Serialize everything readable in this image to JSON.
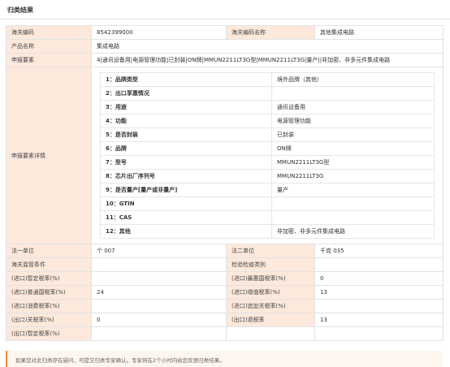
{
  "header": {
    "title": "归类结果"
  },
  "basic": {
    "hs_code_label": "海关编码",
    "hs_code": "8542399000",
    "hs_name_label": "海关编码名称",
    "hs_name": "其他集成电路",
    "product_label": "产品名称",
    "product": "集成电路",
    "elements_label": "申报要素",
    "elements": "4|通讯设备用|电源管理功能|已封装|ON牌|MMUN2211LT3G型|MMUN2211LT3G|量产||非加密、非多元件集成电路",
    "details_label": "申报要素详情"
  },
  "details": [
    {
      "key": "1：品牌类型",
      "value": "境外品牌（其他）"
    },
    {
      "key": "2：出口享惠情况",
      "value": ""
    },
    {
      "key": "3：用途",
      "value": "通讯设备用"
    },
    {
      "key": "4：功能",
      "value": "电源管理功能"
    },
    {
      "key": "5：是否封装",
      "value": "已封装"
    },
    {
      "key": "6：品牌",
      "value": "ON牌"
    },
    {
      "key": "7：型号",
      "value": "MMUN2211LT3G型"
    },
    {
      "key": "8：芯片出厂序列号",
      "value": "MMUN2211LT3G"
    },
    {
      "key": "9：是否量产[量产或非量产]",
      "value": "量产"
    },
    {
      "key": "10：GTIN",
      "value": ""
    },
    {
      "key": "11：CAS",
      "value": ""
    },
    {
      "key": "12：其他",
      "value": "非加密、非多元件集成电路"
    }
  ],
  "units": {
    "unit1_label": "法一单位",
    "unit1": "个 007",
    "unit2_label": "法二单位",
    "unit2": "千克 035",
    "supervision_label": "海关监管条件",
    "supervision": "",
    "inspection_label": "检验检疫类别",
    "inspection": ""
  },
  "rates": [
    {
      "l1": "(进口)暂定税率(%)",
      "v1": "",
      "l2": "(进口)最惠国税率(%)",
      "v2": "0"
    },
    {
      "l1": "(进口)普通国税率(%)",
      "v1": "24",
      "l2": "(进口)增值税率(%)",
      "v2": "13"
    },
    {
      "l1": "(进口)消费税率(%)",
      "v1": "",
      "l2": "(进口)追加关税率(%)",
      "v2": ""
    },
    {
      "l1": "(出口)关税率(%)",
      "v1": "0",
      "l2": "(出口)退税率",
      "v2": "13"
    }
  ],
  "rate_last": {
    "l1": "(出口)暂定税率(%)",
    "v1": ""
  },
  "note": {
    "text": "如果您对此归类存在疑问，可提交归类专家确认。专家将在2个小时内给您反馈归类结果。"
  }
}
